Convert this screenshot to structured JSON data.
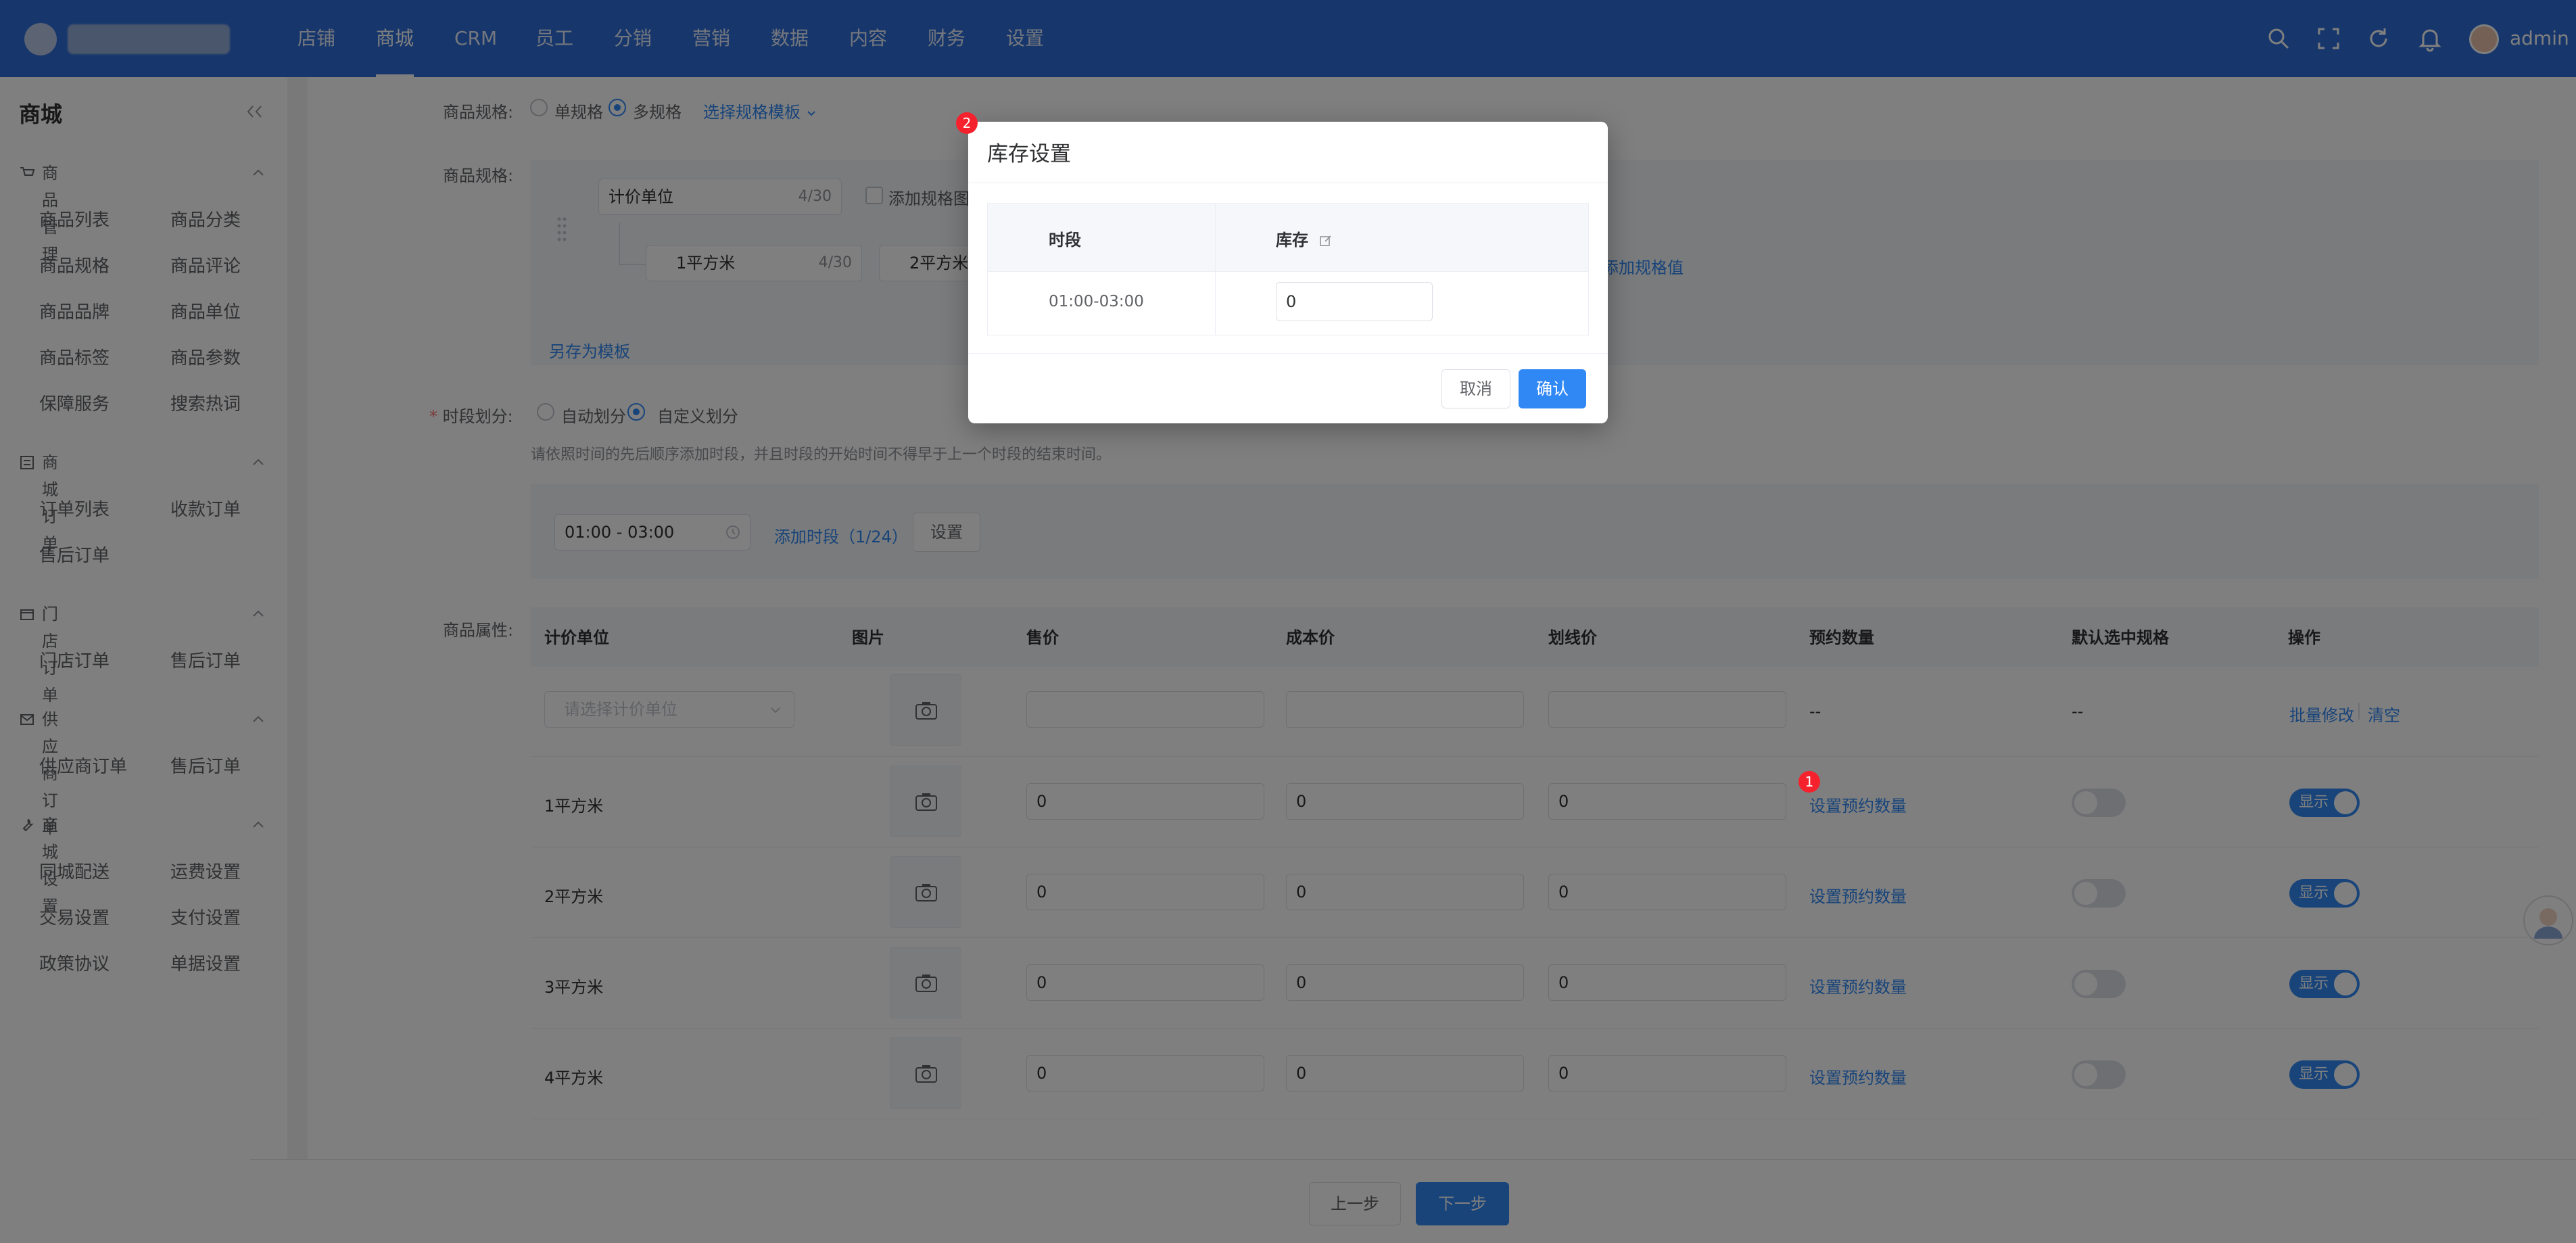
{
  "topbar": {
    "brand_name": "",
    "nav": [
      "店铺",
      "商城",
      "CRM",
      "员工",
      "分销",
      "营销",
      "数据",
      "内容",
      "财务",
      "设置"
    ],
    "active_nav": "商城",
    "icons": [
      "search-icon",
      "fullscreen-icon",
      "refresh-icon",
      "bell-icon"
    ],
    "user": "admin"
  },
  "sidebar": {
    "title": "商城",
    "sections": [
      {
        "title": "商品管理",
        "icon": "cart-icon",
        "items": [
          "商品列表",
          "商品分类",
          "商品规格",
          "商品评论",
          "商品品牌",
          "商品单位",
          "商品标签",
          "商品参数",
          "保障服务",
          "搜索热词"
        ]
      },
      {
        "title": "商城订单",
        "icon": "list-icon",
        "items": [
          "订单列表",
          "收款订单",
          "售后订单"
        ]
      },
      {
        "title": "门店订单",
        "icon": "store-icon",
        "items": [
          "门店订单",
          "售后订单"
        ]
      },
      {
        "title": "供应商订单",
        "icon": "mail-icon",
        "items": [
          "供应商订单",
          "售后订单"
        ]
      },
      {
        "title": "商城设置",
        "icon": "wrench-icon",
        "items": [
          "同城配送",
          "运费设置",
          "交易设置",
          "支付设置",
          "政策协议",
          "单据设置"
        ]
      }
    ]
  },
  "form": {
    "spec_label": "商品规格:",
    "spec_single": "单规格",
    "spec_multi": "多规格",
    "choose_template": "选择规格模板",
    "spec_label2": "商品规格:",
    "unit_field": "计价单位",
    "unit_count": "4/30",
    "add_spec_image": "添加规格图",
    "value1": "1平方米",
    "value1_count": "4/30",
    "value2": "2平方米",
    "add_spec_value": "添加规格值",
    "save_template": "另存为模板",
    "period_label": "时段划分:",
    "auto_period": "自动划分",
    "custom_period": "自定义划分",
    "period_hint": "请依照时间的先后顺序添加时段，并且时段的开始时间不得早于上一个时段的结束时间。",
    "period_value": "01:00 - 03:00",
    "add_period": "添加时段（1/24）",
    "set_button": "设置",
    "attr_label": "商品属性:"
  },
  "table": {
    "headers": [
      "计价单位",
      "图片",
      "售价",
      "成本价",
      "划线价",
      "预约数量",
      "默认选中规格",
      "操作"
    ],
    "batch_row": {
      "unit_placeholder": "请选择计价单位",
      "quota": "--",
      "default": "--",
      "batch_edit": "批量修改",
      "clear": "清空"
    },
    "rows": [
      {
        "unit": "1平方米",
        "price": "0",
        "cost": "0",
        "line_price": "0",
        "quota_link": "设置预约数量",
        "show_label": "显示"
      },
      {
        "unit": "2平方米",
        "price": "0",
        "cost": "0",
        "line_price": "0",
        "quota_link": "设置预约数量",
        "show_label": "显示"
      },
      {
        "unit": "3平方米",
        "price": "0",
        "cost": "0",
        "line_price": "0",
        "quota_link": "设置预约数量",
        "show_label": "显示"
      },
      {
        "unit": "4平方米",
        "price": "0",
        "cost": "0",
        "line_price": "0",
        "quota_link": "设置预约数量",
        "show_label": "显示"
      }
    ]
  },
  "footer": {
    "prev": "上一步",
    "next": "下一步"
  },
  "dialog": {
    "title": "库存设置",
    "col_period": "时段",
    "col_stock": "库存",
    "period": "01:00-03:00",
    "stock_value": "0",
    "cancel": "取消",
    "confirm": "确认"
  },
  "badges": {
    "one": "1",
    "two": "2"
  },
  "colors": {
    "topbar": "#2f6fd8",
    "primary": "#3088f5",
    "badge": "#f5222d"
  }
}
